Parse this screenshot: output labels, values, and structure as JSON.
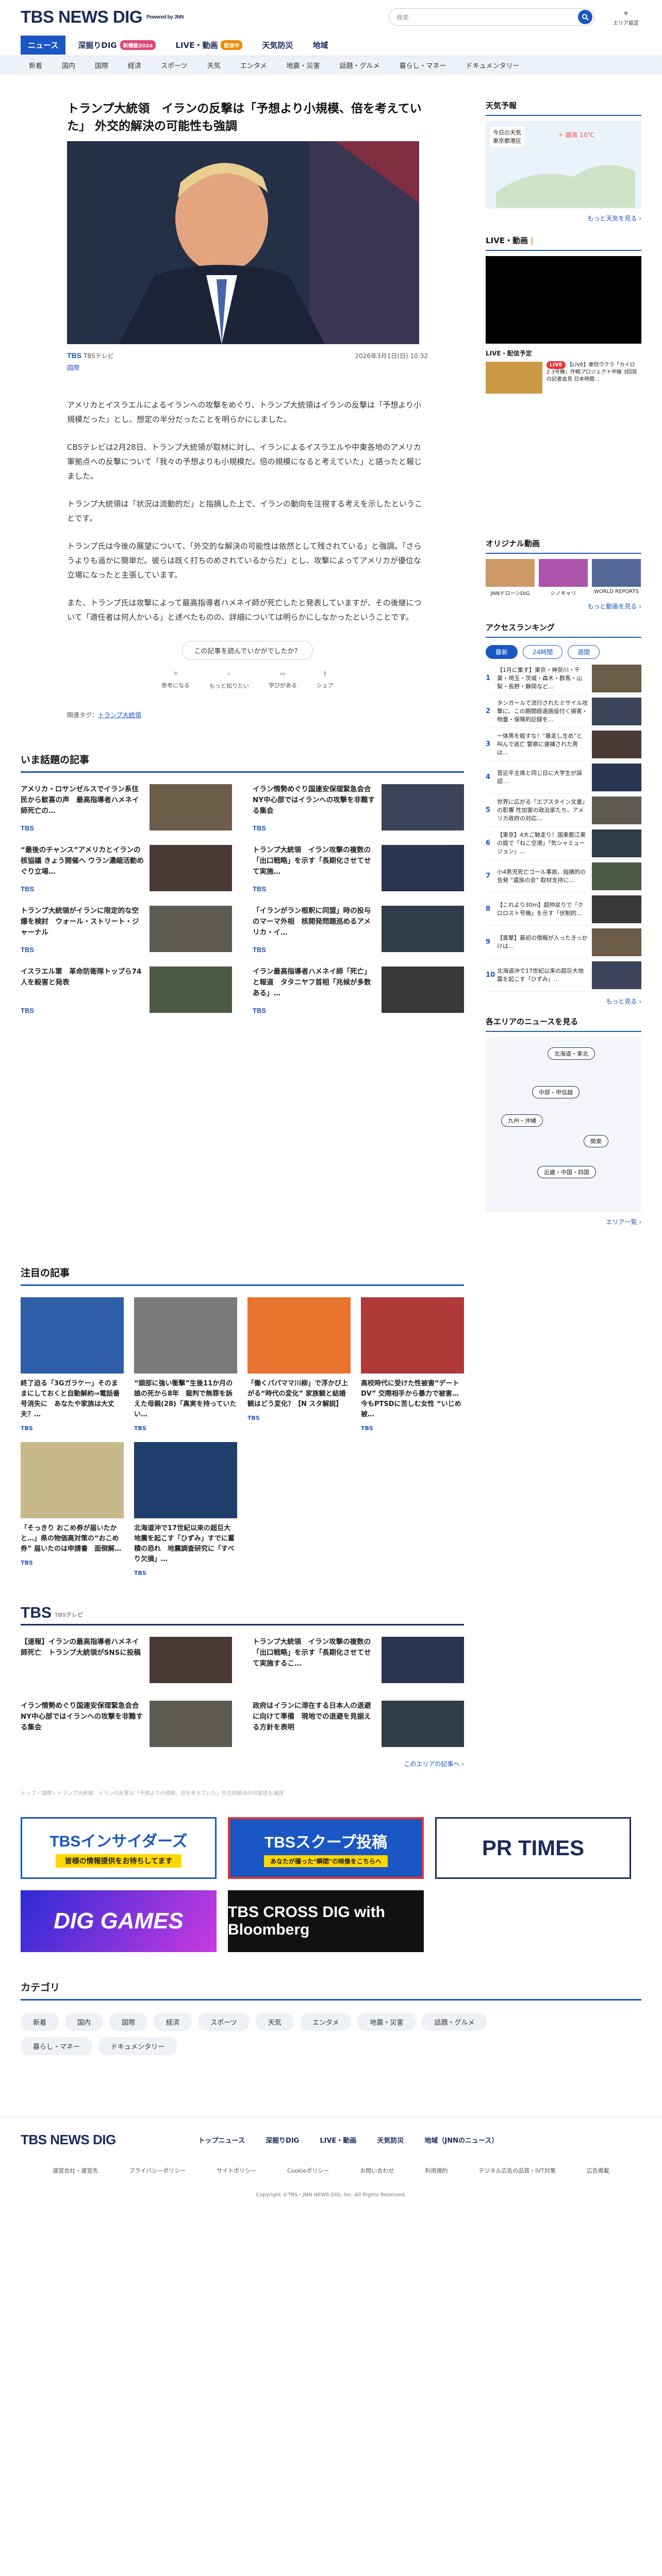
{
  "header": {
    "logo": "TBS NEWS DIG",
    "powered": "Powered by JNN",
    "search_placeholder": "検索",
    "region": "エリア設定"
  },
  "tabs": [
    {
      "label": "ニュース"
    },
    {
      "label": "深掘りDIG",
      "badge": "新機能2024"
    },
    {
      "label": "LIVE・動画",
      "badge": "配信中"
    },
    {
      "label": "天気防災"
    },
    {
      "label": "地域"
    }
  ],
  "subnav": [
    "新着",
    "国内",
    "国際",
    "経済",
    "スポーツ",
    "天気",
    "エンタメ",
    "地震・災害",
    "話題・グルメ",
    "暮らし・マネー",
    "ドキュメンタリー"
  ],
  "article": {
    "title": "トランプ大統領　イランの反撃は「予想より小規模、倍を考えていた」 外交的解決の可能性も強調",
    "source": "TBSテレビ",
    "category": "国際",
    "date": "2026年3月1日(日) 10:32",
    "paragraphs": [
      "アメリカとイスラエルによるイランへの攻撃をめぐり、トランプ大統領はイランの反撃は「予想より小規模だった」とし、想定の半分だったことを明らかにしました。",
      "CBSテレビは2月28日、トランプ大統領が取材に対し、イランによるイスラエルや中東各地のアメリカ軍拠点への反撃について「我々の予想よりも小規模だ。倍の規模になると考えていた」と語ったと報じました。",
      "トランプ大統領は「状況は流動的だ」と指摘した上で、イランの動向を注視する考えを示したということです。",
      "トランプ氏は今後の展望について、「外交的な解決の可能性は依然として残されている」と強調。「さらうよりも遥かに簡単だ。彼らは既く打ちのめされているからだ」とし、攻撃によってアメリカが優位な立場になったと主張しています。",
      "また、トランプ氏は攻撃によって最高指導者ハメネイ師が死亡したと発表していますが、その後継について「適任者は何人かいる」と述べたものの、詳細については明らかにしなかったということです。"
    ],
    "feedback_question": "この記事を読んでいかがでしたか？",
    "reactions": [
      "参考になる",
      "もっと知りたい",
      "学びがある",
      "シェア"
    ],
    "tags_label": "関連タグ：",
    "tag": "トランプ大統領"
  },
  "trending": {
    "title": "いま話題の記事",
    "items": [
      {
        "title": "アメリカ・ロサンゼルスでイラン系住民から歓喜の声　最高指導者ハメネイ師死亡の…",
        "src": "TBS"
      },
      {
        "title": "イラン情勢めぐり国連安保理緊急会合　NY中心部ではイランへの攻撃を非難する集会",
        "src": "TBS"
      },
      {
        "title": "“最後のチャンス”アメリカとイランの核協議 きょう開催へ ウラン濃縮活動めぐり立場…",
        "src": "TBS"
      },
      {
        "title": "トランプ大統領　イラン攻撃の複数の「出口戦略」を示す「長期化させてせて実施…",
        "src": "TBS"
      },
      {
        "title": "トランプ大統領がイランに限定的な空爆を検討　ウォール・ストリート・ジャーナル",
        "src": "TBS"
      },
      {
        "title": "「イランがラン根釈に同盟」時の投与のマーマ外相　核開発問題巡めるアメリカ・イ…",
        "src": "TBS"
      },
      {
        "title": "イスラエル軍　革命防衛隊トップら74人を殺害と発表",
        "src": "TBS"
      },
      {
        "title": "イラン最高指導者ハメネイ師「死亡」と報道　タタニヤフ首相「兆候が多数ある」…",
        "src": "TBS"
      }
    ]
  },
  "featured": {
    "title": "注目の記事",
    "items": [
      {
        "title": "終了迫る「3Gガラケー」そのままにしておくと自動解約⇒電話番号消失に　あなたや家族は大丈夫？…",
        "src": "TBS"
      },
      {
        "title": "“頭部に強い衝撃”生後11か月の娘の死から8年　裁判で無罪を訴えた母親(28)「真実を持っていたい…",
        "src": "TBS"
      },
      {
        "title": "「働くパパママ川柳」で浮かび上がる“時代の変化” 家族観と結婚観はどう変化？【N スタ解説】",
        "src": "TBS"
      },
      {
        "title": "高校時代に受けた性被害“デートDV” 交際相手から暴力で被害…今もPTSDに苦しむ女性 “いじめ被…",
        "src": "TBS"
      },
      {
        "title": "「そっきり おこめ券が届いたかと…」県の物価高対策の“おこめ券” 届いたのは申請書　面倒解…",
        "src": "TBS"
      },
      {
        "title": "北海道沖で17世紀以来の超巨大地震を起こす「ひずみ」すでに蓄積の恐れ　地震調査研究に「すべり欠損」…",
        "src": "TBS"
      }
    ]
  },
  "tbs_block": {
    "logo": "TBS",
    "sub": "TBSテレビ",
    "items": [
      {
        "title": "【速報】イランの最高指導者ハメネイ師死亡　トランプ大統領がSNSに投稿"
      },
      {
        "title": "トランプ大統領　イラン攻撃の複数の「出口戦略」を示す「長期化させてせて実施するこ…"
      },
      {
        "title": "イラン情勢めぐり国連安保理緊急会合　NY中心部ではイランへの攻撃を非難する集会"
      },
      {
        "title": "政府はイランに滞在する日本人の退避に向けて準備　現地での退避を見据える方針を表明"
      }
    ],
    "more": "このエリアの記事へ ›"
  },
  "breadcrumb": "トップ › 国際 › トランプ大統領　イランの反撃は「予想より小規模、倍を考えていた」外交的解決の可能性も強調",
  "banners": [
    "TBSインサイダーズ",
    "TBSスクープ投稿",
    "PR TIMES",
    "DIG GAMES",
    "TBS CROSS DIG with Bloomberg"
  ],
  "insiders_sub": "皆様の情報提供をお待ちしてます",
  "scoop_sub": "あなたが撮った“瞬間”の映像をこちらへ",
  "categories": {
    "title": "カテゴリ",
    "items": [
      "新着",
      "国内",
      "国際",
      "経済",
      "スポーツ",
      "天気",
      "エンタメ",
      "地震・災害",
      "話題・グルメ",
      "暮らし・マネー",
      "ドキュメンタリー"
    ]
  },
  "sidebar": {
    "weather_title": "天気予報",
    "weather_today": "今日の天気",
    "weather_region": "東京都港区",
    "weather_high": "最高",
    "weather_temp": "10℃",
    "weather_more": "もっと天気を見る ›",
    "live_title": "LIVE・動画",
    "live_sched": "LIVE・配信予定",
    "live_status": "LIVE",
    "live_item": "【LIVE】衆院ウクラ「カイロ2.3号機」作戦プロジェクト中継 3回目の記者会見 日本時間…",
    "original_title": "オリジナル動画",
    "original_items": [
      "JNNドローンDIG",
      "シノキャリ",
      "WORLD REPORTS"
    ],
    "original_more": "もっと動画を見る ›",
    "ranking_title": "アクセスランキング",
    "ranking_tabs": [
      "最新",
      "24時間",
      "週間"
    ],
    "ranking": [
      "【1月に集す】東京・神奈川・千葉・埼玉・茨城・森木・群馬・山梨・長野・静岡など…",
      "タンガールで流行されたミサイル攻撃に、この期間経過施設付く損害・物量・保険的記録を…",
      "一体男を殺すな！“暴走し生め”と叫んで逃亡 警察に速捕された男は…",
      "習近平主席と同じ日に大学生が誤認…",
      "世界に広がる「エプスタイン文書」の影響 性加害の政治家たち、アメリカ政府の対応…",
      "【東京】4大ご馳走り！国東都江東の庭で「ねこ空港」「気シャミュージョン」…",
      "小4男児死亡ゴール事故、指摘的の告発 “遺族の会” 取材支持に…",
      "【これより30m】超仲戻りで「クロロスト号機」を示す「伏制的…",
      "【直撃】最初の情報が入ったきっかけは…",
      "北海道沖で17世紀以来の超巨大地震を起こす「ひずみ」…"
    ],
    "ranking_more": "もっと見る ›",
    "area_title": "各エリアのニュースを見る",
    "area_labels": [
      "北海道・東北",
      "中部・甲信越",
      "九州・沖縄",
      "関東",
      "近畿・中国・四国"
    ],
    "area_more": "エリア一覧 ›"
  },
  "footer": {
    "links": [
      "トップニュース",
      "深掘りDIG",
      "LIVE・動画",
      "天気防災",
      "地域（JNNのニュース）"
    ],
    "sub": [
      "運営会社・運営先",
      "プライバシーポリシー",
      "サイトポリシー",
      "Cookieポリシー",
      "お問い合わせ",
      "利用規約",
      "デジタル広告の品質・IVT対策",
      "広告掲載"
    ],
    "copyright": "Copyright ©TBS・JNN NEWS DIG, Inc. All Rights Reserved."
  }
}
